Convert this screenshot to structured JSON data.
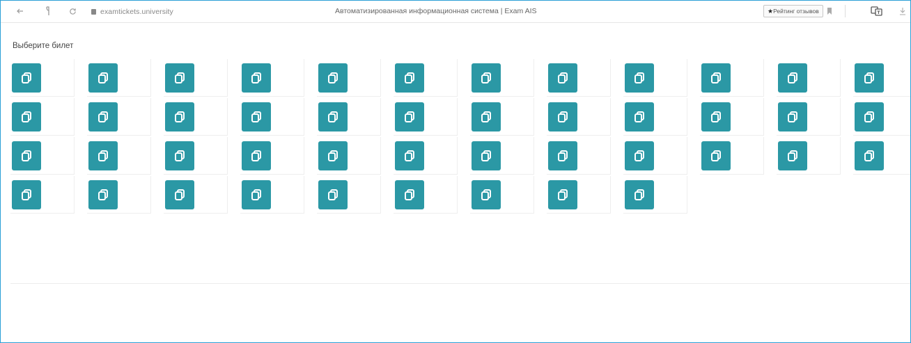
{
  "browser": {
    "url": "examtickets.university",
    "title": "Автоматизированная информационная система | Exam AIS",
    "rating_label": "Рейтинг отзывов"
  },
  "page": {
    "heading": "Выберите билет"
  },
  "tickets": {
    "count": 45,
    "columns": 12,
    "icon": "copy-icon",
    "button_color": "#2b98a5"
  },
  "colors": {
    "accent": "#2b98a5",
    "frame_border": "#2a9fd6"
  }
}
